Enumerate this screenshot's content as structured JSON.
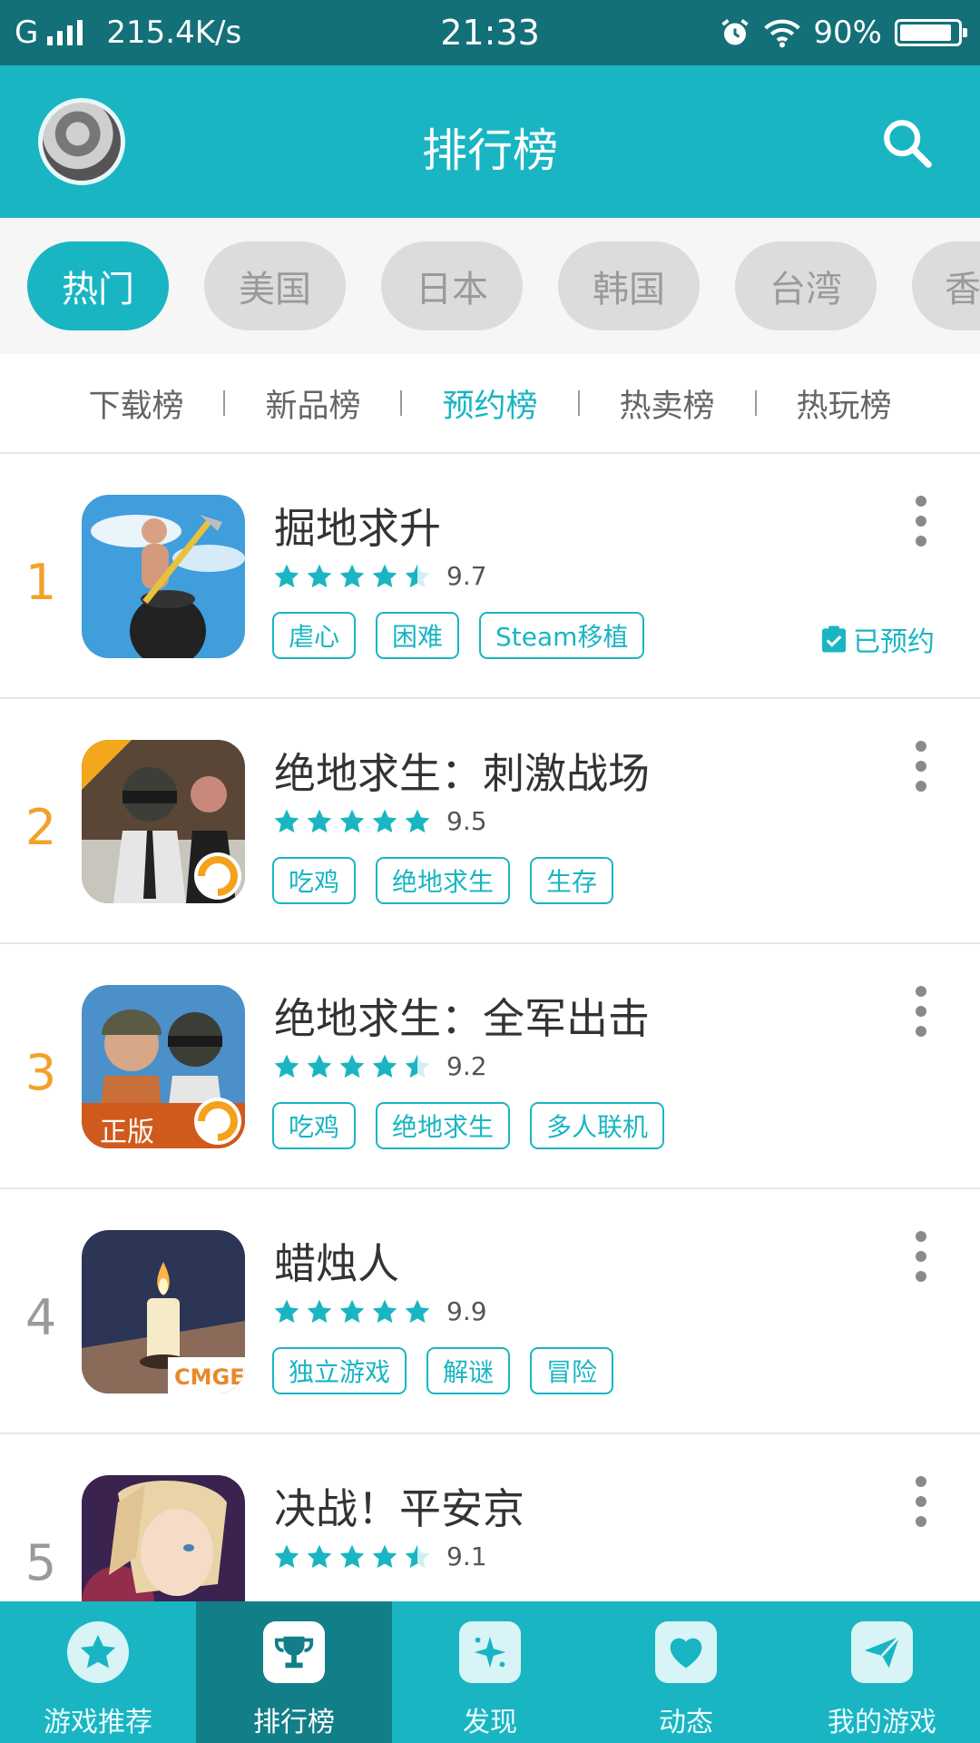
{
  "status_bar": {
    "carrier": "G",
    "network_speed": "215.4K/s",
    "time": "21:33",
    "battery": "90%",
    "battery_level": 0.9
  },
  "header": {
    "title": "排行榜"
  },
  "regions": [
    "热门",
    "美国",
    "日本",
    "韩国",
    "台湾",
    "香"
  ],
  "active_region": "热门",
  "rank_tabs": [
    "下载榜",
    "新品榜",
    "预约榜",
    "热卖榜",
    "热玩榜"
  ],
  "active_rank_tab": "预约榜",
  "games": [
    {
      "rank": "1",
      "name": "掘地求升",
      "rating": 4.5,
      "score": "9.7",
      "tags": [
        "虐心",
        "困难",
        "Steam移植"
      ],
      "reserved_label": "已预约"
    },
    {
      "rank": "2",
      "name": "绝地求生：刺激战场",
      "rating": 5,
      "score": "9.5",
      "tags": [
        "吃鸡",
        "绝地求生",
        "生存"
      ]
    },
    {
      "rank": "3",
      "name": "绝地求生：全军出击",
      "rating": 4.5,
      "score": "9.2",
      "tags": [
        "吃鸡",
        "绝地求生",
        "多人联机"
      ],
      "icon_badge": "正版"
    },
    {
      "rank": "4",
      "name": "蜡烛人",
      "rating": 5,
      "score": "9.9",
      "tags": [
        "独立游戏",
        "解谜",
        "冒险"
      ],
      "icon_badge": "CMGE"
    },
    {
      "rank": "5",
      "name": "决战！平安京",
      "rating": 4.5,
      "score": "9.1",
      "tags": []
    }
  ],
  "bottom_nav": [
    {
      "label": "游戏推荐",
      "icon": "star-icon"
    },
    {
      "label": "排行榜",
      "icon": "trophy-icon"
    },
    {
      "label": "发现",
      "icon": "sparkle-icon"
    },
    {
      "label": "动态",
      "icon": "heart-icon"
    },
    {
      "label": "我的游戏",
      "icon": "paper-plane-icon"
    }
  ],
  "colors": {
    "accent": "#19b5c3",
    "status_bar": "#137078",
    "rank_top": "#f2a22b",
    "nav_active": "#127e88"
  }
}
